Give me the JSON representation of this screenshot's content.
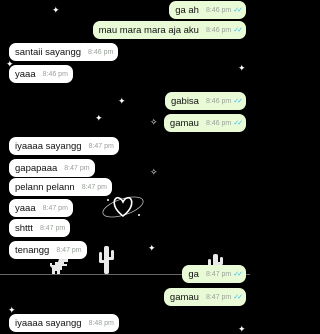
{
  "conversation": {
    "messages": [
      {
        "direction": "out",
        "text": "ga ah",
        "time": "8:46 pm",
        "ticks": "✓✓"
      },
      {
        "direction": "out",
        "text": "mau mara mara aja aku",
        "time": "8:46 pm",
        "ticks": "✓✓"
      },
      {
        "direction": "in",
        "text": "santaii sayangg",
        "time": "8:46 pm"
      },
      {
        "direction": "in",
        "text": "yaaa",
        "time": "8:46 pm"
      },
      {
        "direction": "out",
        "text": "gabisa",
        "time": "8:46 pm",
        "ticks": "✓✓"
      },
      {
        "direction": "out",
        "text": "gamau",
        "time": "8:46 pm",
        "ticks": "✓✓"
      },
      {
        "direction": "in",
        "text": "iyaaaa sayangg",
        "time": "8:47 pm"
      },
      {
        "direction": "in",
        "text": "gapapaaa",
        "time": "8:47 pm"
      },
      {
        "direction": "in",
        "text": "pelann pelann",
        "time": "8:47 pm"
      },
      {
        "direction": "in",
        "text": "yaaa",
        "time": "8:47 pm"
      },
      {
        "direction": "in",
        "text": "shttt",
        "time": "8:47 pm"
      },
      {
        "direction": "in",
        "text": "tenangg",
        "time": "8:47 pm"
      },
      {
        "direction": "out",
        "text": "ga",
        "time": "8:47 pm",
        "ticks": "✓✓"
      },
      {
        "direction": "out",
        "text": "gamau",
        "time": "8:47 pm",
        "ticks": "✓✓"
      },
      {
        "direction": "in",
        "text": "iyaaaa sayangg",
        "time": "8:48 pm"
      }
    ]
  },
  "theme": {
    "background": "#000000",
    "incoming_bubble": "#ffffff",
    "outgoing_bubble": "#e9fbd6",
    "read_ticks": "#34b7f1"
  },
  "decorations": [
    "heart-icon",
    "sparkle-star-icon",
    "dino-icon",
    "cactus-icon"
  ]
}
